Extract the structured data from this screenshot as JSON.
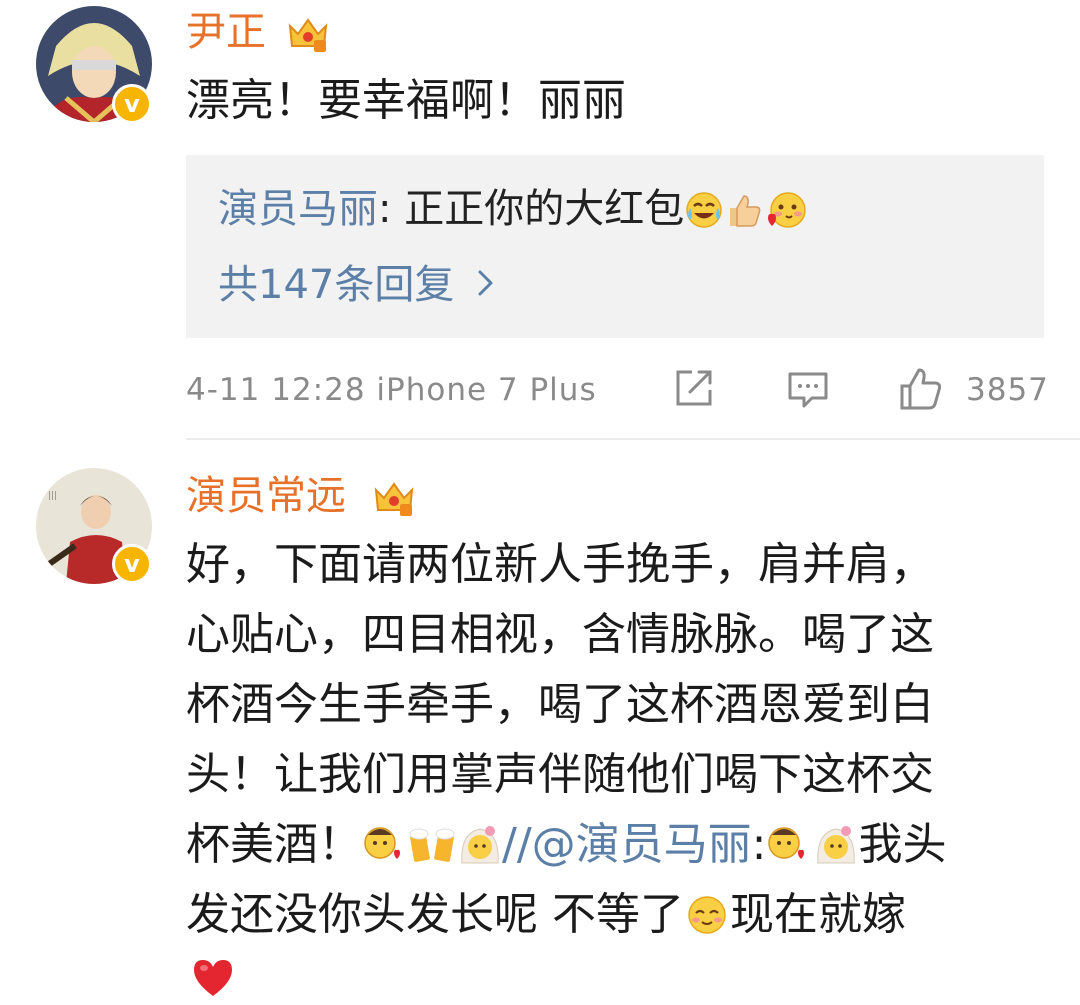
{
  "comments": [
    {
      "username": "尹正",
      "text": "漂亮！要幸福啊！丽丽",
      "reply": {
        "author": "演员马丽",
        "separator": ":",
        "body": "正正你的大红包",
        "emojis": [
          "laughing-crying-emoji",
          "thumbs-up-emoji",
          "love-heart-emoji"
        ],
        "count_label": "共147条回复"
      },
      "date": "4-11",
      "time": "12:28",
      "device": "iPhone 7 Plus",
      "likes": "3857"
    },
    {
      "username": "演员常远",
      "lines": [
        "好，下面请两位新人手挽手，肩并肩，",
        "心贴心，四目相视，含情脉脉。喝了这",
        "杯酒今生手牵手，喝了这杯酒恩爱到白",
        "头！让我们用掌声伴随他们喝下这杯交"
      ],
      "line5_prefix": "杯美酒！",
      "forward_marker": "//",
      "mention": "@演员马丽",
      "mention_separator": ":",
      "line5_suffix": "我头",
      "line6_prefix": "发还没你头发长呢 不等了",
      "line6_suffix": "现在就嫁",
      "emojis": [
        "kiss-emoji",
        "cheers-beer-emoji",
        "bride-emoji",
        "kiss-emoji",
        "bride-emoji",
        "shy-smile-emoji",
        "red-heart-emoji"
      ]
    }
  ],
  "colors": {
    "username": "#e8712a",
    "link": "#5c7fa7",
    "meta": "#8a8a8a",
    "reply_bg": "#f2f2f2",
    "verified_badge": "#f7b500"
  }
}
